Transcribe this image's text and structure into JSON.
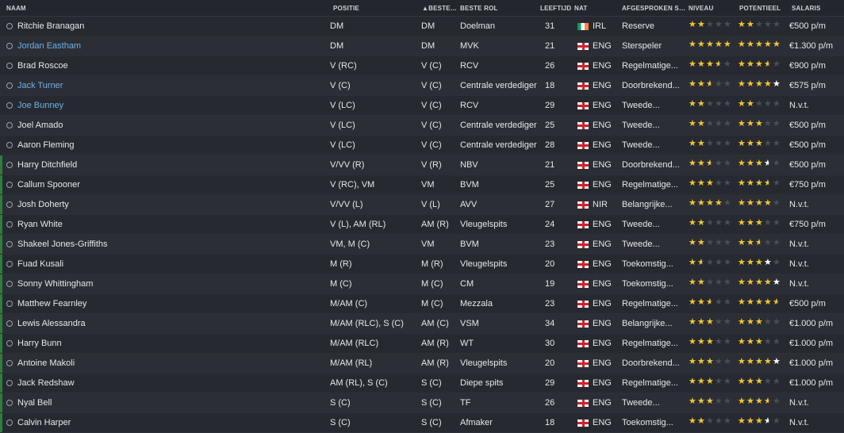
{
  "columns": {
    "naam": "NAAM",
    "positie": "POSITIE",
    "beste_pos": "BESTE POS",
    "sort_indicator": "▲",
    "beste_rol": "BESTE ROL",
    "leeftijd": "LEEFTIJD",
    "nat": "NAT",
    "afgesproken": "AFGESPROKEN SPE...",
    "niveau": "NIVEAU",
    "potentieel": "POTENTIEEL",
    "salaris": "SALARIS"
  },
  "colors": {
    "star_gold": "#f2c531",
    "star_empty": "#4a4e56",
    "link": "#6fb0ea",
    "edge_green": "#2e7d3c"
  },
  "players": [
    {
      "name": "Ritchie Branagan",
      "link": false,
      "edge": false,
      "position": "DM",
      "best_pos": "DM",
      "role": "Doelman",
      "age": "31",
      "nat": "IRL",
      "flag": "irl",
      "agreed": "Reserve",
      "niveau": 2,
      "pot": 2,
      "pot_white": false,
      "salary": "€500 p/m"
    },
    {
      "name": "Jordan Eastham",
      "link": true,
      "edge": false,
      "position": "DM",
      "best_pos": "DM",
      "role": "MVK",
      "age": "21",
      "nat": "ENG",
      "flag": "eng",
      "agreed": "Sterspeler",
      "niveau": 5,
      "pot": 5,
      "pot_white": false,
      "salary": "€1.300 p/m"
    },
    {
      "name": "Brad Roscoe",
      "link": false,
      "edge": false,
      "position": "V (RC)",
      "best_pos": "V (C)",
      "role": "RCV",
      "age": "26",
      "nat": "ENG",
      "flag": "eng",
      "agreed": "Regelmatige...",
      "niveau": 3.5,
      "pot": 3.5,
      "pot_white": false,
      "salary": "€900 p/m"
    },
    {
      "name": "Jack Turner",
      "link": true,
      "edge": false,
      "position": "V (C)",
      "best_pos": "V (C)",
      "role": "Centrale verdediger",
      "age": "18",
      "nat": "ENG",
      "flag": "eng",
      "agreed": "Doorbrekend...",
      "niveau": 2.5,
      "pot": 5,
      "pot_white": true,
      "salary": "€575 p/m"
    },
    {
      "name": "Joe Bunney",
      "link": true,
      "edge": false,
      "position": "V (LC)",
      "best_pos": "V (C)",
      "role": "RCV",
      "age": "29",
      "nat": "ENG",
      "flag": "eng",
      "agreed": "Tweede...",
      "niveau": 2,
      "pot": 2,
      "pot_white": false,
      "salary": "N.v.t."
    },
    {
      "name": "Joel Amado",
      "link": false,
      "edge": false,
      "position": "V (LC)",
      "best_pos": "V (C)",
      "role": "Centrale verdediger",
      "age": "25",
      "nat": "ENG",
      "flag": "eng",
      "agreed": "Tweede...",
      "niveau": 2,
      "pot": 3,
      "pot_white": false,
      "salary": "€500 p/m"
    },
    {
      "name": "Aaron Fleming",
      "link": false,
      "edge": false,
      "position": "V (LC)",
      "best_pos": "V (C)",
      "role": "Centrale verdediger",
      "age": "28",
      "nat": "ENG",
      "flag": "eng",
      "agreed": "Tweede...",
      "niveau": 2,
      "pot": 3,
      "pot_white": false,
      "salary": "€500 p/m"
    },
    {
      "name": "Harry Ditchfield",
      "link": false,
      "edge": true,
      "position": "V/VV (R)",
      "best_pos": "V (R)",
      "role": "NBV",
      "age": "21",
      "nat": "ENG",
      "flag": "eng",
      "agreed": "Doorbrekend...",
      "niveau": 2.5,
      "pot": 3.5,
      "pot_white": true,
      "salary": "€500 p/m"
    },
    {
      "name": "Callum Spooner",
      "link": false,
      "edge": true,
      "position": "V (RC), VM",
      "best_pos": "VM",
      "role": "BVM",
      "age": "25",
      "nat": "ENG",
      "flag": "eng",
      "agreed": "Regelmatige...",
      "niveau": 3,
      "pot": 3.5,
      "pot_white": false,
      "salary": "€750 p/m"
    },
    {
      "name": "Josh Doherty",
      "link": false,
      "edge": true,
      "position": "V/VV (L)",
      "best_pos": "V (L)",
      "role": "AVV",
      "age": "27",
      "nat": "NIR",
      "flag": "nir",
      "agreed": "Belangrijke...",
      "niveau": 4,
      "pot": 4,
      "pot_white": false,
      "salary": "N.v.t."
    },
    {
      "name": "Ryan White",
      "link": false,
      "edge": true,
      "position": "V (L), AM (RL)",
      "best_pos": "AM (R)",
      "role": "Vleugelspits",
      "age": "24",
      "nat": "ENG",
      "flag": "eng",
      "agreed": "Tweede...",
      "niveau": 2,
      "pot": 3,
      "pot_white": false,
      "salary": "€750 p/m"
    },
    {
      "name": "Shakeel Jones-Griffiths",
      "link": false,
      "edge": true,
      "position": "VM, M (C)",
      "best_pos": "VM",
      "role": "BVM",
      "age": "23",
      "nat": "ENG",
      "flag": "eng",
      "agreed": "Tweede...",
      "niveau": 2,
      "pot": 2.5,
      "pot_white": false,
      "salary": "N.v.t."
    },
    {
      "name": "Fuad Kusali",
      "link": false,
      "edge": true,
      "position": "M (R)",
      "best_pos": "M (R)",
      "role": "Vleugelspits",
      "age": "20",
      "nat": "ENG",
      "flag": "eng",
      "agreed": "Toekomstig...",
      "niveau": 1.5,
      "pot": 4,
      "pot_white": true,
      "salary": "N.v.t."
    },
    {
      "name": "Sonny Whittingham",
      "link": false,
      "edge": true,
      "position": "M (C)",
      "best_pos": "M (C)",
      "role": "CM",
      "age": "19",
      "nat": "ENG",
      "flag": "eng",
      "agreed": "Toekomstig...",
      "niveau": 2,
      "pot": 5,
      "pot_white": true,
      "salary": "N.v.t."
    },
    {
      "name": "Matthew Fearnley",
      "link": false,
      "edge": true,
      "position": "M/AM (C)",
      "best_pos": "M (C)",
      "role": "Mezzala",
      "age": "23",
      "nat": "ENG",
      "flag": "eng",
      "agreed": "Regelmatige...",
      "niveau": 2.5,
      "pot": 4.5,
      "pot_white": false,
      "salary": "€500 p/m"
    },
    {
      "name": "Lewis Alessandra",
      "link": false,
      "edge": true,
      "position": "M/AM (RLC), S (C)",
      "best_pos": "AM (C)",
      "role": "VSM",
      "age": "34",
      "nat": "ENG",
      "flag": "eng",
      "agreed": "Belangrijke...",
      "niveau": 3,
      "pot": 3,
      "pot_white": false,
      "salary": "€1.000 p/m"
    },
    {
      "name": "Harry Bunn",
      "link": false,
      "edge": true,
      "position": "M/AM (RLC)",
      "best_pos": "AM (R)",
      "role": "WT",
      "age": "30",
      "nat": "ENG",
      "flag": "eng",
      "agreed": "Regelmatige...",
      "niveau": 3,
      "pot": 3,
      "pot_white": false,
      "salary": "€1.000 p/m"
    },
    {
      "name": "Antoine Makoli",
      "link": false,
      "edge": true,
      "position": "M/AM (RL)",
      "best_pos": "AM (R)",
      "role": "Vleugelspits",
      "age": "20",
      "nat": "ENG",
      "flag": "eng",
      "agreed": "Doorbrekend...",
      "niveau": 3,
      "pot": 5,
      "pot_white": true,
      "salary": "€1.000 p/m"
    },
    {
      "name": "Jack Redshaw",
      "link": false,
      "edge": true,
      "position": "AM (RL), S (C)",
      "best_pos": "S (C)",
      "role": "Diepe spits",
      "age": "29",
      "nat": "ENG",
      "flag": "eng",
      "agreed": "Regelmatige...",
      "niveau": 3,
      "pot": 3,
      "pot_white": false,
      "salary": "€1.000 p/m"
    },
    {
      "name": "Nyal Bell",
      "link": false,
      "edge": true,
      "position": "S (C)",
      "best_pos": "S (C)",
      "role": "TF",
      "age": "26",
      "nat": "ENG",
      "flag": "eng",
      "agreed": "Tweede...",
      "niveau": 3,
      "pot": 3.5,
      "pot_white": false,
      "salary": "N.v.t."
    },
    {
      "name": "Calvin Harper",
      "link": false,
      "edge": true,
      "position": "S (C)",
      "best_pos": "S (C)",
      "role": "Afmaker",
      "age": "18",
      "nat": "ENG",
      "flag": "eng",
      "agreed": "Toekomstig...",
      "niveau": 2,
      "pot": 3.5,
      "pot_white": true,
      "salary": "N.v.t."
    }
  ]
}
